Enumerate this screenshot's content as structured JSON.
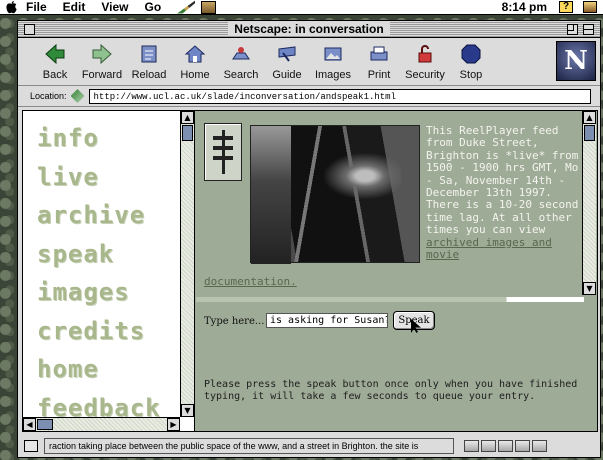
{
  "menubar": {
    "items": [
      "File",
      "Edit",
      "View",
      "Go"
    ],
    "clock": "8:14 pm",
    "help_glyph": "?"
  },
  "window": {
    "title": "Netscape: in conversation"
  },
  "toolbar": {
    "buttons": [
      {
        "label": "Back",
        "icon": "back-arrow-icon"
      },
      {
        "label": "Forward",
        "icon": "forward-arrow-icon"
      },
      {
        "label": "Reload",
        "icon": "reload-icon"
      },
      {
        "label": "Home",
        "icon": "home-icon"
      },
      {
        "label": "Search",
        "icon": "search-icon"
      },
      {
        "label": "Guide",
        "icon": "guide-icon"
      },
      {
        "label": "Images",
        "icon": "images-icon"
      },
      {
        "label": "Print",
        "icon": "print-icon"
      },
      {
        "label": "Security",
        "icon": "security-lock-icon"
      },
      {
        "label": "Stop",
        "icon": "stop-icon"
      }
    ],
    "logo_letter": "N"
  },
  "location": {
    "label": "Location:",
    "url": "http://www.ucl.ac.uk/slade/inconversation/andspeak1.html"
  },
  "nav": {
    "links": [
      "info",
      "live",
      "archive",
      "speak",
      "images",
      "credits",
      "home",
      "feedback"
    ]
  },
  "feed": {
    "text": "This ReelPlayer feed from Duke Street, Brighton is *live* from 1500 - 1900 hrs GMT, Mo - Sa, November 14th - December 13th 1997. There is a 10-20 second time lag. At all other times you can view",
    "link_text": "archived images and movie",
    "doc_link": "documentation."
  },
  "speak": {
    "prompt": "Type here...",
    "input_value": "is asking for Susan?",
    "button_label": "Speak",
    "note": "Please press the speak button once only when you have finished typing, it will take a few seconds to queue your entry."
  },
  "status": {
    "message": "raction taking place between the public space of the www, and a street in Brighton.  the site is"
  },
  "colors": {
    "nav_text": "#a9b88c",
    "content_bg": "#9eab97",
    "link": "#58684e"
  }
}
